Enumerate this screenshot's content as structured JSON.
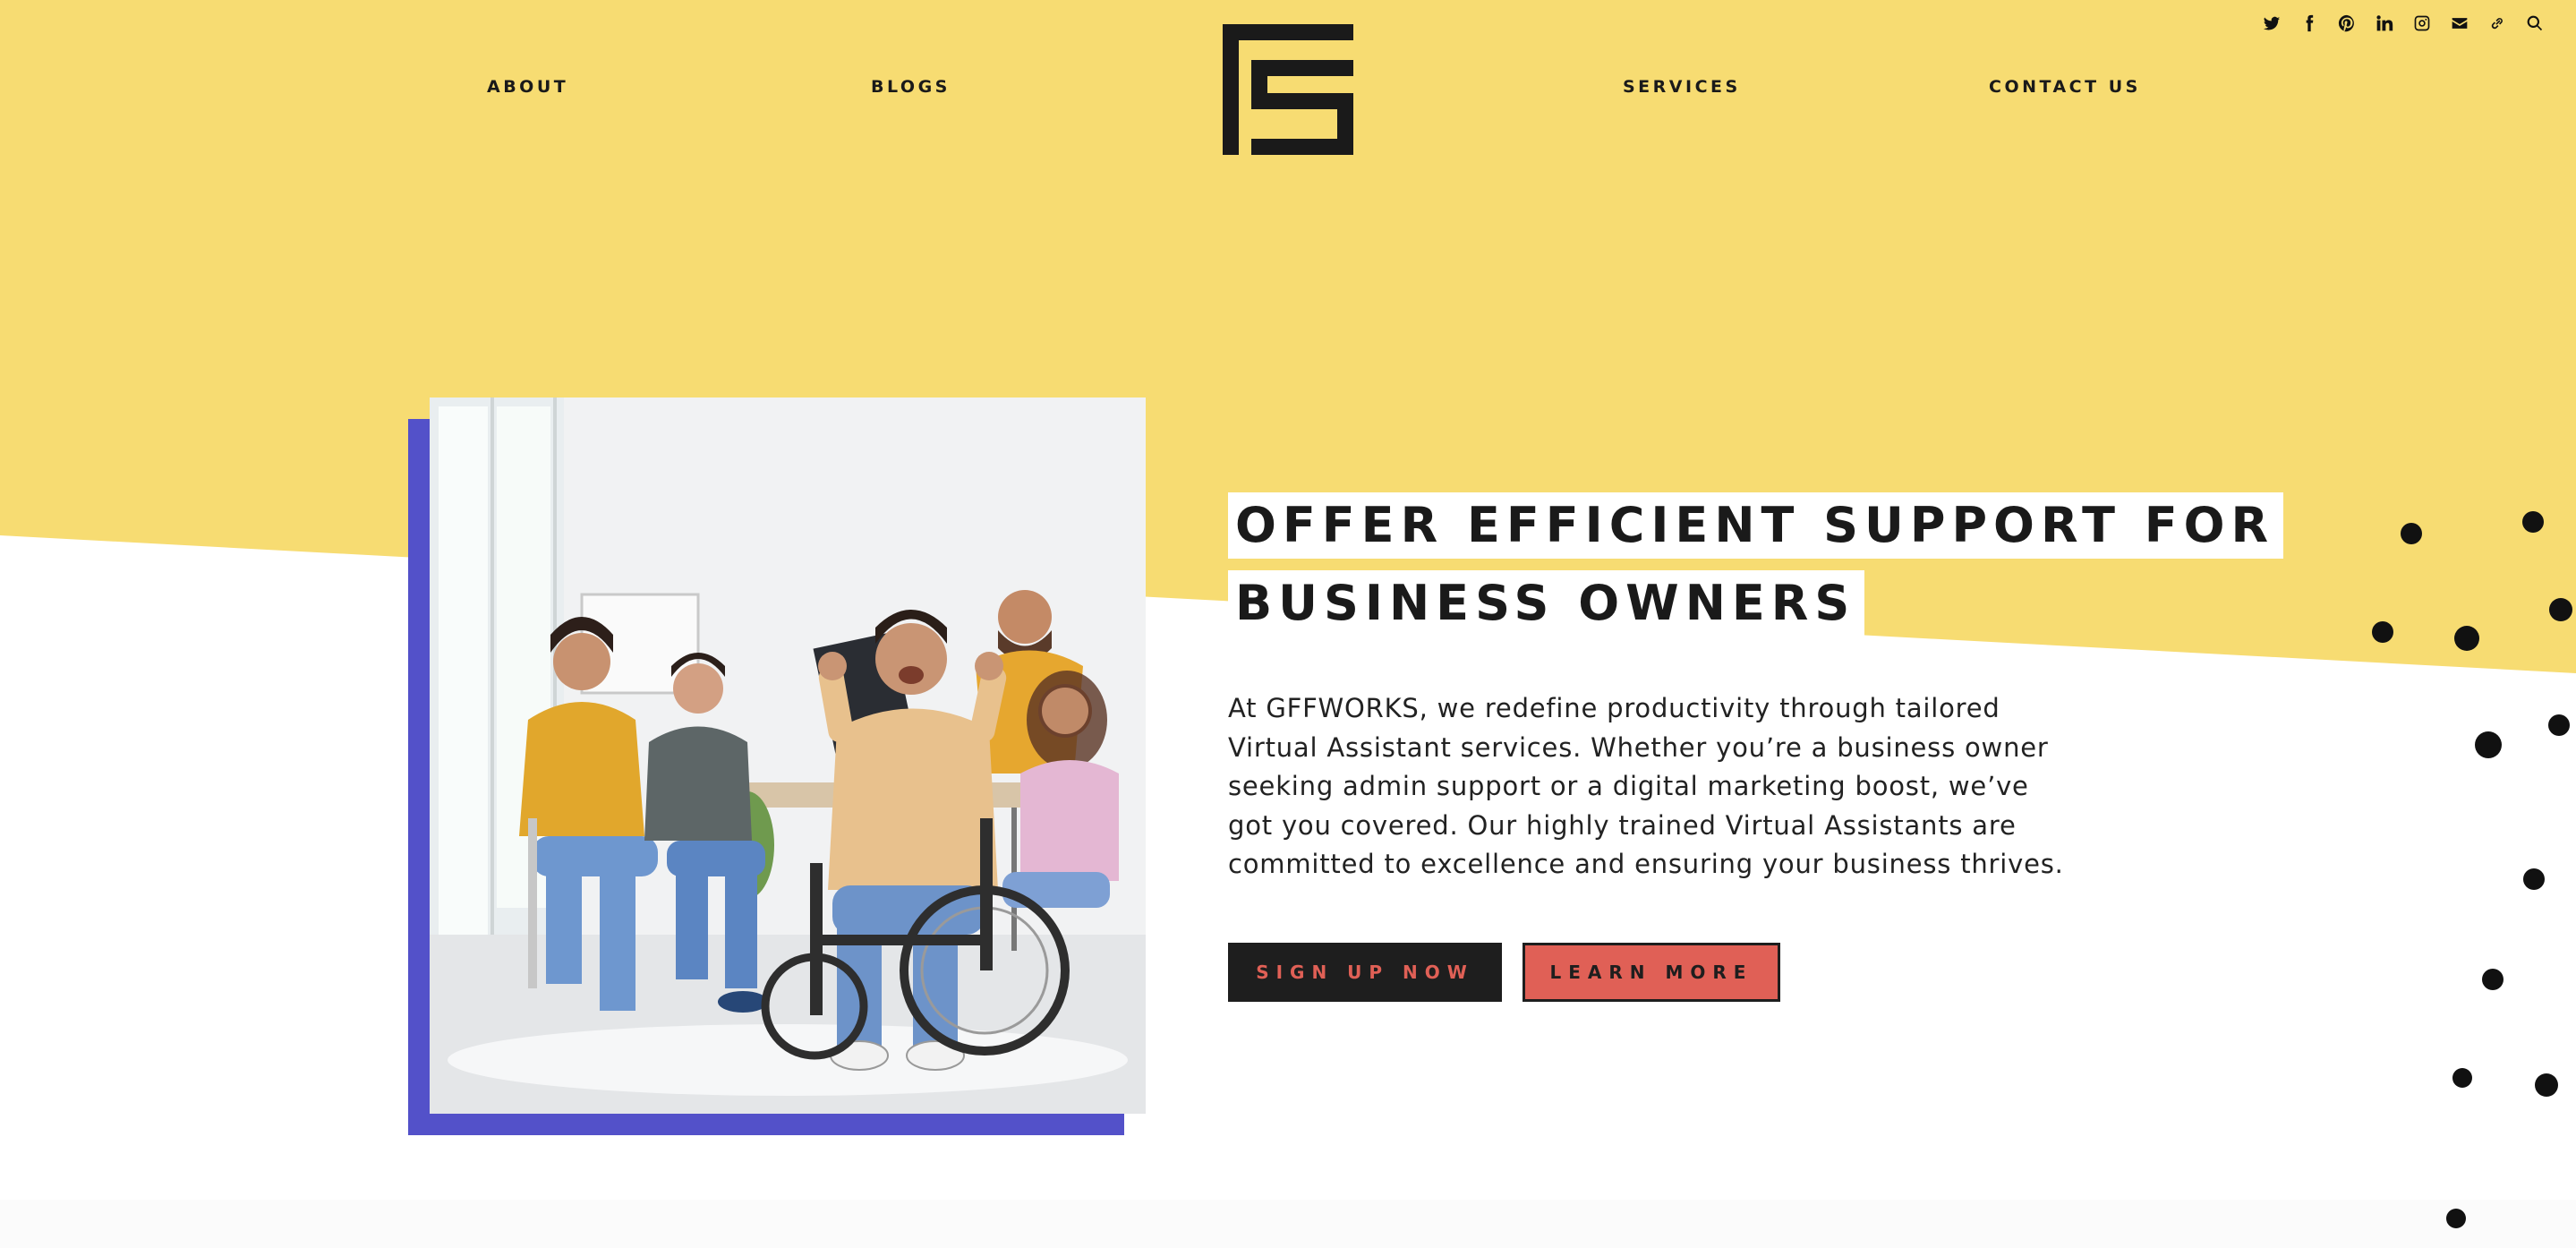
{
  "nav": {
    "about": "ABOUT",
    "blogs": "BLOGS",
    "services": "SERVICES",
    "contact": "CONTACT US"
  },
  "social_icons": [
    "twitter-icon",
    "facebook-icon",
    "pinterest-icon",
    "linkedin-icon",
    "instagram-icon",
    "email-icon",
    "link-icon",
    "search-icon"
  ],
  "hero": {
    "headline_line1": "OFFER EFFICIENT SUPPORT FOR",
    "headline_line2": "BUSINESS OWNERS",
    "body": "At GFFWORKS, we redefine productivity through tailored Virtual Assistant services. Whether you’re a business owner seeking admin support or a digital marketing boost, we’ve got you covered. Our highly trained Virtual Assistants are committed to excellence and ensuring your business thrives.",
    "signup_label": "SIGN UP NOW",
    "learn_label": "LEARN MORE"
  },
  "colors": {
    "yellow": "#f7dc72",
    "purple": "#5351c9",
    "coral": "#e06056",
    "dark": "#1e1e1e"
  }
}
